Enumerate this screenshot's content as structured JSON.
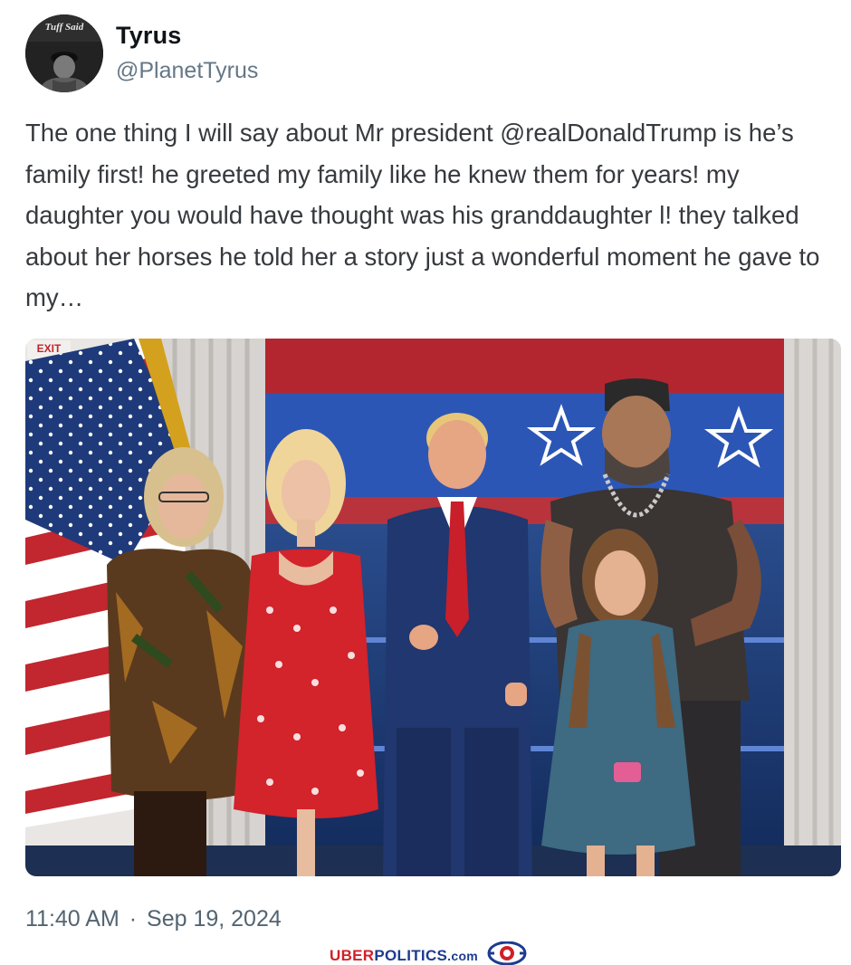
{
  "author": {
    "display_name": "Tyrus",
    "handle": "@PlanetTyrus",
    "avatar_caption": "Tuff Said"
  },
  "tweet": {
    "text": "The one thing I will say about Mr president @realDonaldTrump is he’s family first! he greeted my family like he knew them for years! my daughter you would have thought was his granddaughter l! they talked about her horses he told her a story just a wonderful moment he gave to my…",
    "time": "11:40 AM",
    "separator": "·",
    "date": "Sep 19, 2024"
  },
  "media": {
    "type": "photo",
    "exit_sign_text": "EXIT"
  },
  "watermark": {
    "brand_part1": "UBER",
    "brand_part2": "POLITICS",
    "brand_part3": ".com"
  },
  "colors": {
    "text_primary": "#0f1419",
    "text_body": "#36393d",
    "text_secondary": "#536471",
    "brand_red": "#d0202a",
    "brand_blue": "#1d3b8f"
  }
}
